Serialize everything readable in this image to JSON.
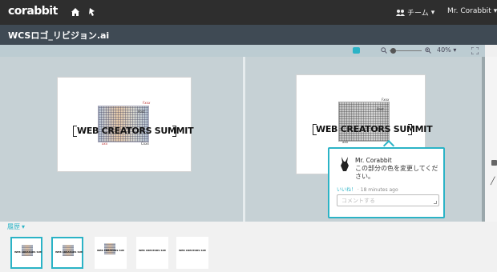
{
  "topbar": {
    "brand": "corabbit",
    "team_label": "チーム",
    "user_label": "Mr. Corabbit"
  },
  "file": {
    "title": "WCSロゴ_リビジョン.ai"
  },
  "toolbar": {
    "zoom_level": "40%",
    "zoom_slider_fraction": 0.1
  },
  "artwork": {
    "logo_text": "WEB CREATORS SUMMIT"
  },
  "comment": {
    "author": "Mr. Corabbit",
    "text": "この部分の色を変更してください。",
    "like_label": "いいね！",
    "time_sep": " · ",
    "time": "18 minutes ago",
    "input_placeholder": "コメントする"
  },
  "history": {
    "label": "履歴",
    "thumbnails": [
      {
        "label": "WEB CREATORS SUMMIT",
        "active": true,
        "grid": true
      },
      {
        "label": "WEB CREATORS SUMMIT",
        "active": true,
        "grid": true
      },
      {
        "label": "WEB CREATORS SUMMIT",
        "active": false,
        "grid": true
      },
      {
        "label": "WEB CREATORS SUMMIT",
        "active": false,
        "grid": false
      },
      {
        "label": "WEB CREATORS SUMMIT",
        "active": false,
        "grid": false
      }
    ]
  },
  "colors": {
    "accent": "#2bb3c6",
    "topbar": "#2e2e2e",
    "filebar": "#3f4a54",
    "canvas": "#c6d1d5"
  },
  "icons": {
    "home": "home-icon",
    "theme": "palette-icon",
    "team": "team-icon",
    "chat": "chat-icon",
    "zoom_out": "zoom-out-icon",
    "zoom_in": "zoom-in-icon",
    "fullscreen": "fullscreen-icon",
    "pen": "pen-icon"
  }
}
